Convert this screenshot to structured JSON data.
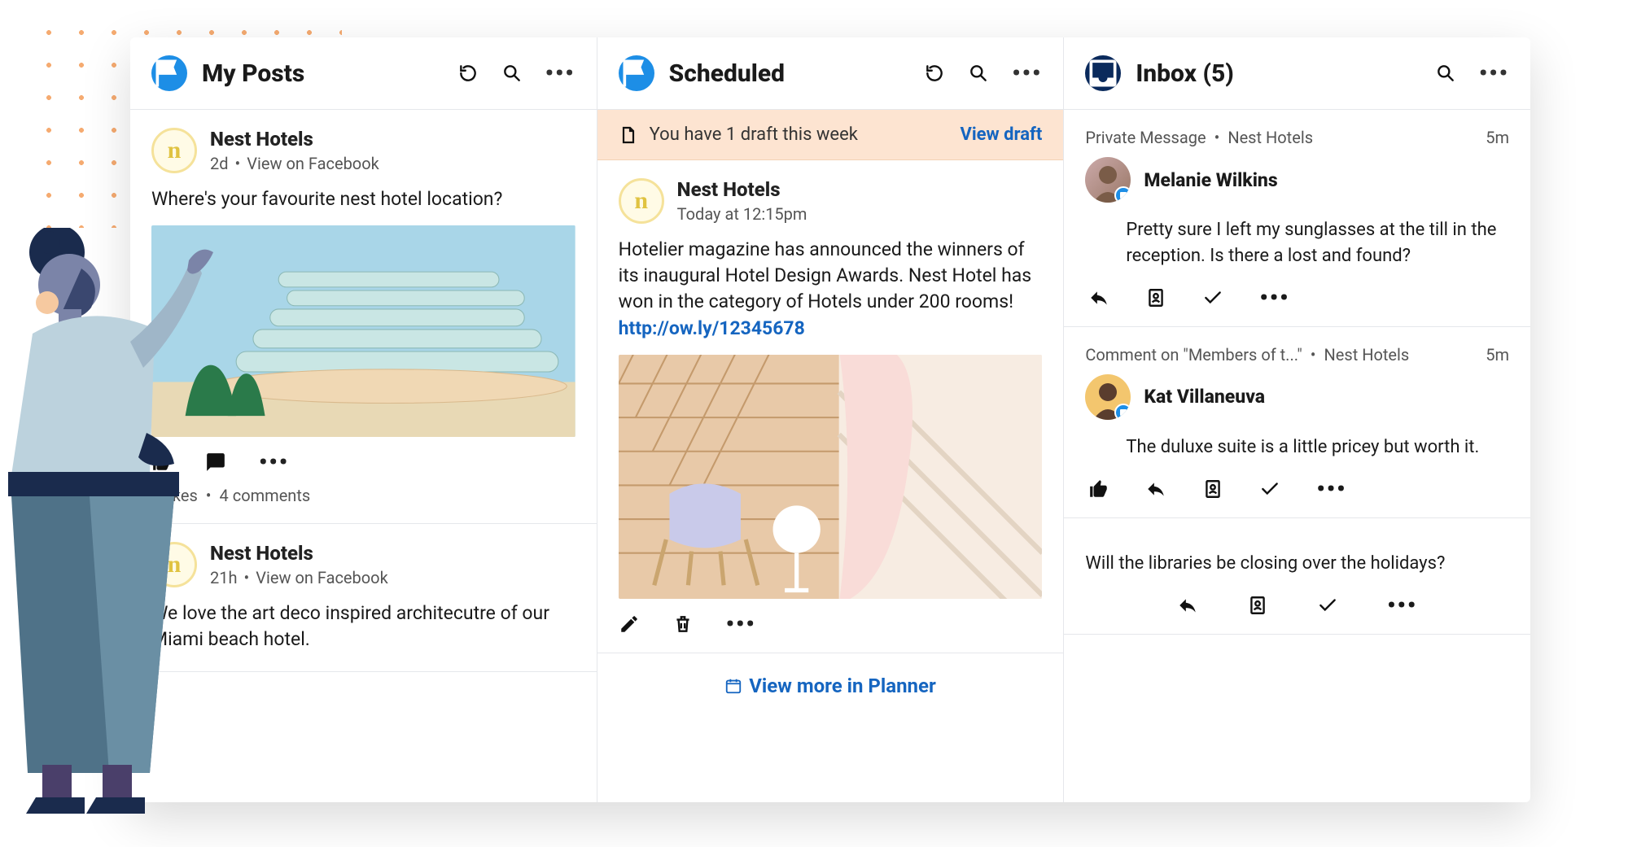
{
  "columns": {
    "myPosts": {
      "title": "My Posts",
      "posts": [
        {
          "author": "Nest Hotels",
          "age": "2d",
          "viewOn": "View on Facebook",
          "text": "Where's your favourite nest hotel location?",
          "likes": "2 likes",
          "comments": "4 comments"
        },
        {
          "author": "Nest Hotels",
          "age": "21h",
          "viewOn": "View on Facebook",
          "text": "We love the art deco inspired architecutre of our Miami beach hotel."
        }
      ]
    },
    "scheduled": {
      "title": "Scheduled",
      "banner": {
        "text": "You have 1 draft this week",
        "link": "View draft"
      },
      "post": {
        "author": "Nest Hotels",
        "time": "Today at 12:15pm",
        "text": "Hotelier magazine has announced the winners of its inaugural Hotel Design Awards. Nest Hotel has won in the category of Hotels under 200 rooms! ",
        "link": "http://ow.ly/12345678"
      },
      "footerLink": "View more in Planner"
    },
    "inbox": {
      "title": "Inbox (5)",
      "items": [
        {
          "type": "Private Message",
          "source": "Nest Hotels",
          "age": "5m",
          "user": "Melanie Wilkins",
          "text": "Pretty sure I left my sunglasses at the till in the reception. Is there a lost and found?"
        },
        {
          "type": "Comment on \"Members of t...\"",
          "source": "Nest Hotels",
          "age": "5m",
          "user": "Kat Villaneuva",
          "text": "The duluxe suite is a little pricey but worth it."
        },
        {
          "text": "Will the libraries be closing over the holidays?"
        }
      ]
    }
  }
}
